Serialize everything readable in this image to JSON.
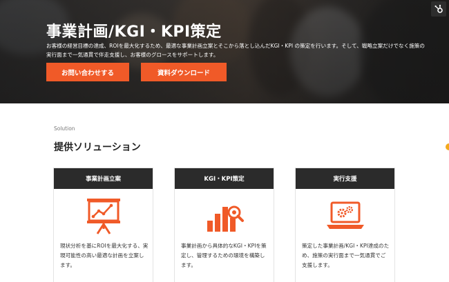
{
  "hero": {
    "title": "事業計画/KGI・KPI策定",
    "description": "お客様の経営目標の達成、ROIを最大化するため、最適な事業計画立案とそこから落とし込んだKGI・KPI の策定を行います。そして、戦略立案だけでなく施策の実行面まで一気通貫で伴走支援し、お客様のグロースをサポートします。",
    "buttons": {
      "contact": "お問い合わせする",
      "download": "資料ダウンロード"
    },
    "badge_icon": "hubspot-icon"
  },
  "solution": {
    "eyebrow": "Solution",
    "title": "提供ソリューション",
    "cards": [
      {
        "title": "事業計画立案",
        "icon": "presentation-chart-icon",
        "text": "現状分析を基にROIを最大化する、実現可能性の高い最適な計画を立案します。"
      },
      {
        "title": "KGI・KPI策定",
        "icon": "bar-chart-search-icon",
        "text": "事業計画から具体的なKGI・KPIを策定し、管理するための環境を構築します。"
      },
      {
        "title": "実行支援",
        "icon": "laptop-gears-icon",
        "text": "策定した事業計画/KGI・KPI達成のため、施策の実行面まで一気通貫でご支援します。"
      }
    ]
  },
  "colors": {
    "accent": "#f05a28",
    "card_header": "#2b2b2b",
    "side_dot": "#f3a91b"
  }
}
